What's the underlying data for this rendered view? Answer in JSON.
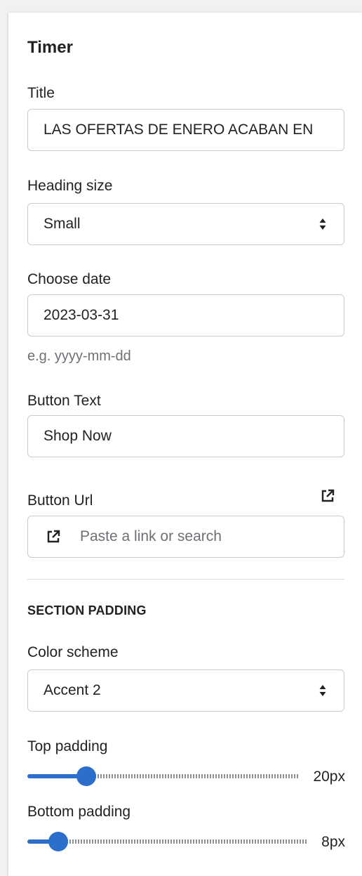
{
  "section": {
    "title": "Timer"
  },
  "title_field": {
    "label": "Title",
    "value": "LAS OFERTAS DE ENERO ACABAN EN"
  },
  "heading_size": {
    "label": "Heading size",
    "value": "Small"
  },
  "date_field": {
    "label": "Choose date",
    "value": "2023-03-31",
    "help": "e.g. yyyy-mm-dd"
  },
  "button_text": {
    "label": "Button Text",
    "value": "Shop Now"
  },
  "button_url": {
    "label": "Button Url",
    "placeholder": "Paste a link or search"
  },
  "padding_section": {
    "heading": "SECTION PADDING"
  },
  "color_scheme": {
    "label": "Color scheme",
    "value": "Accent 2"
  },
  "top_padding": {
    "label": "Top padding",
    "value_label": "20px",
    "value": 20
  },
  "bottom_padding": {
    "label": "Bottom padding",
    "value_label": "8px",
    "value": 8
  },
  "colors": {
    "accent": "#2c6ecb",
    "border": "#c9cccf",
    "muted": "#6d7175"
  },
  "icons": {
    "external": "external-link-icon",
    "select": "select-arrows-icon"
  }
}
